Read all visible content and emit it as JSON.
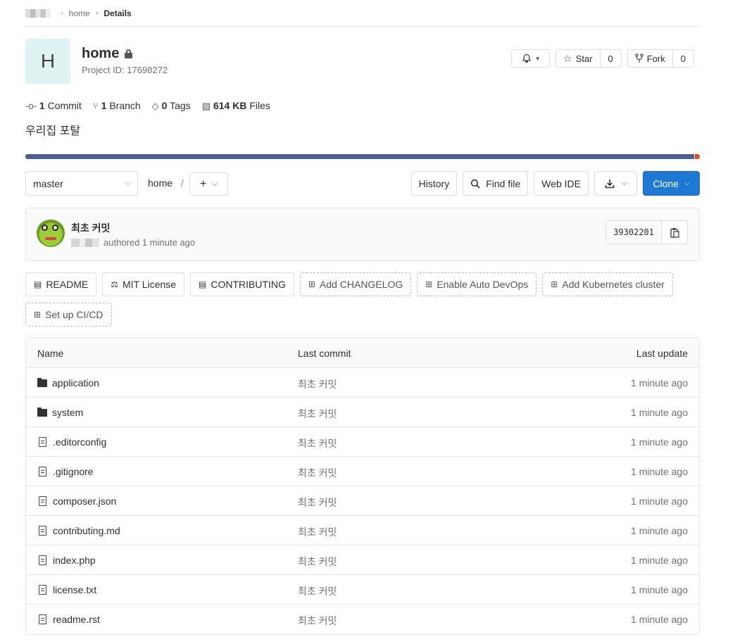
{
  "breadcrumb": {
    "items": [
      "home",
      "Details"
    ]
  },
  "project": {
    "avatar_letter": "H",
    "name": "home",
    "id_text": "Project ID: 17698272",
    "description": "우리집 포탈"
  },
  "header_buttons": {
    "star_label": "Star",
    "star_count": "0",
    "fork_label": "Fork",
    "fork_count": "0"
  },
  "stats": {
    "commits_count": "1",
    "commits_label": "Commit",
    "branches_count": "1",
    "branches_label": "Branch",
    "tags_count": "0",
    "tags_label": "Tags",
    "files_size": "614 KB",
    "files_label": "Files"
  },
  "colors": {
    "php": "#4f5d95",
    "other": "#e44b23",
    "primary": "#1f78d1"
  },
  "tree": {
    "branch": "master",
    "path": "home",
    "path_sep": "/",
    "history": "History",
    "find_file": "Find file",
    "web_ide": "Web IDE",
    "clone": "Clone"
  },
  "last_commit": {
    "title": "최초 커밋",
    "authored": "authored 1 minute ago",
    "sha": "39302201"
  },
  "shortcuts": [
    {
      "label": "README",
      "icon": "doc-icon",
      "dashed": false
    },
    {
      "label": "MIT License",
      "icon": "scale-icon",
      "dashed": false
    },
    {
      "label": "CONTRIBUTING",
      "icon": "doc-icon",
      "dashed": false
    },
    {
      "label": "Add CHANGELOG",
      "icon": "plus-square-icon",
      "dashed": true
    },
    {
      "label": "Enable Auto DevOps",
      "icon": "plus-square-icon",
      "dashed": true
    },
    {
      "label": "Add Kubernetes cluster",
      "icon": "plus-square-icon",
      "dashed": true
    },
    {
      "label": "Set up CI/CD",
      "icon": "plus-square-icon",
      "dashed": true
    }
  ],
  "files": {
    "headers": {
      "name": "Name",
      "commit": "Last commit",
      "update": "Last update"
    },
    "rows": [
      {
        "name": "application",
        "type": "folder",
        "commit": "최초 커밋",
        "update": "1 minute ago"
      },
      {
        "name": "system",
        "type": "folder",
        "commit": "최초 커밋",
        "update": "1 minute ago"
      },
      {
        "name": ".editorconfig",
        "type": "file",
        "commit": "최초 커밋",
        "update": "1 minute ago"
      },
      {
        "name": ".gitignore",
        "type": "file",
        "commit": "최초 커밋",
        "update": "1 minute ago"
      },
      {
        "name": "composer.json",
        "type": "file",
        "commit": "최초 커밋",
        "update": "1 minute ago"
      },
      {
        "name": "contributing.md",
        "type": "file",
        "commit": "최초 커밋",
        "update": "1 minute ago"
      },
      {
        "name": "index.php",
        "type": "file",
        "commit": "최초 커밋",
        "update": "1 minute ago"
      },
      {
        "name": "license.txt",
        "type": "file",
        "commit": "최초 커밋",
        "update": "1 minute ago"
      },
      {
        "name": "readme.rst",
        "type": "file",
        "commit": "최초 커밋",
        "update": "1 minute ago"
      }
    ]
  }
}
